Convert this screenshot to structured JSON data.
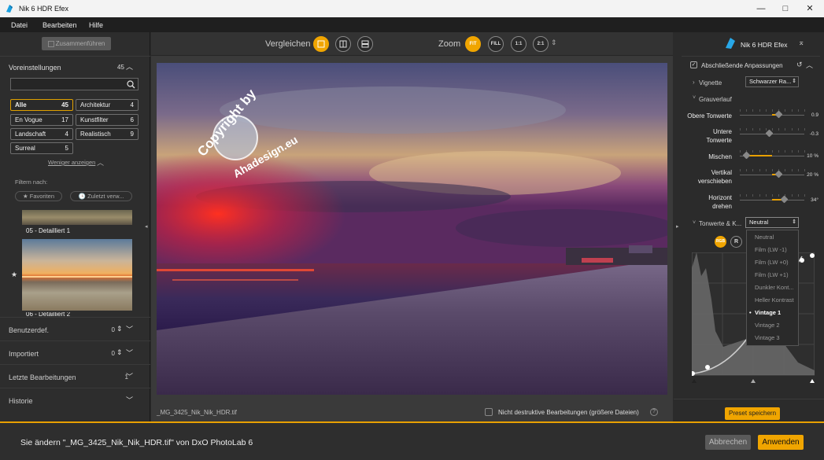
{
  "window": {
    "title": "Nik 6 HDR Efex",
    "min": "—",
    "max": "□",
    "close": "✕"
  },
  "menu": [
    "Datei",
    "Bearbeiten",
    "Hilfe"
  ],
  "left": {
    "merge_btn": "Zusammenführen",
    "presets_label": "Voreinstellungen",
    "presets_count": "45",
    "search_placeholder": "",
    "categories": [
      {
        "name": "Alle",
        "count": "45"
      },
      {
        "name": "Architektur",
        "count": "4"
      },
      {
        "name": "En Vogue",
        "count": "17"
      },
      {
        "name": "Kunstfilter",
        "count": "6"
      },
      {
        "name": "Landschaft",
        "count": "4"
      },
      {
        "name": "Realistisch",
        "count": "9"
      },
      {
        "name": "Surreal",
        "count": "5"
      }
    ],
    "less": "Weniger anzeigen",
    "filter_label": "Filtern nach:",
    "fav": "★ Favoriten",
    "recent": "🕒 Zuletzt verw...",
    "thumb1": "05 - Detailliert 1",
    "thumb2": "06 - Detailliert 2",
    "sections": [
      {
        "label": "Benutzerdef.",
        "count": "0"
      },
      {
        "label": "Importiert",
        "count": "0"
      },
      {
        "label": "Letzte Bearbeitungen",
        "count": "1"
      },
      {
        "label": "Historie",
        "count": ""
      }
    ]
  },
  "center": {
    "compare": "Vergleichen",
    "zoom": "Zoom",
    "zoom_fit": "FIT",
    "zoom_fill": "FILL",
    "zoom_1": "1:1",
    "zoom_2": "2:1",
    "filename": "_MG_3425_Nik_Nik_HDR.tif",
    "nondestructive": "Nicht destruktive Bearbeitungen (größere Dateien)",
    "watermark_top": "Copyright by",
    "watermark_bottom": "Ahadesign.eu"
  },
  "right": {
    "app": "Nik 6 HDR Efex",
    "final": "Abschließende Anpassungen",
    "vignette": "Vignette",
    "vignette_value": "Schwarzer Ra...",
    "grad": "Grauverlauf",
    "sliders": [
      {
        "l1": "Obere Tonwerte",
        "l2": "",
        "value": "0.9",
        "pos": 0.6
      },
      {
        "l1": "Untere",
        "l2": "Tonwerte",
        "value": "-0.3",
        "pos": 0.45
      },
      {
        "l1": "Mischen",
        "l2": "",
        "value": "10 %",
        "pos": 0.1
      },
      {
        "l1": "Vertikal",
        "l2": "verschieben",
        "value": "20 %",
        "pos": 0.6
      },
      {
        "l1": "Horizont",
        "l2": "drehen",
        "value": "34°",
        "pos": 0.68
      }
    ],
    "tonal": "Tonwerte & K...",
    "tonal_value": "Neutral",
    "rgb": "RGB",
    "r": "R",
    "dropdown": [
      "Neutral",
      "Film (LW -1)",
      "Film (LW +0)",
      "Film (LW +1)",
      "Dunkler Kont...",
      "Heller Kontrast",
      "Vintage 1",
      "Vintage 2",
      "Vintage 3"
    ],
    "dropdown_selected": "Vintage 1",
    "save_preset": "Preset speichern"
  },
  "bottom": {
    "message": "Sie ändern \"_MG_3425_Nik_Nik_HDR.tif\" von DxO PhotoLab 6",
    "cancel": "Abbrechen",
    "apply": "Anwenden"
  },
  "colors": {
    "accent": "#f0a500"
  }
}
